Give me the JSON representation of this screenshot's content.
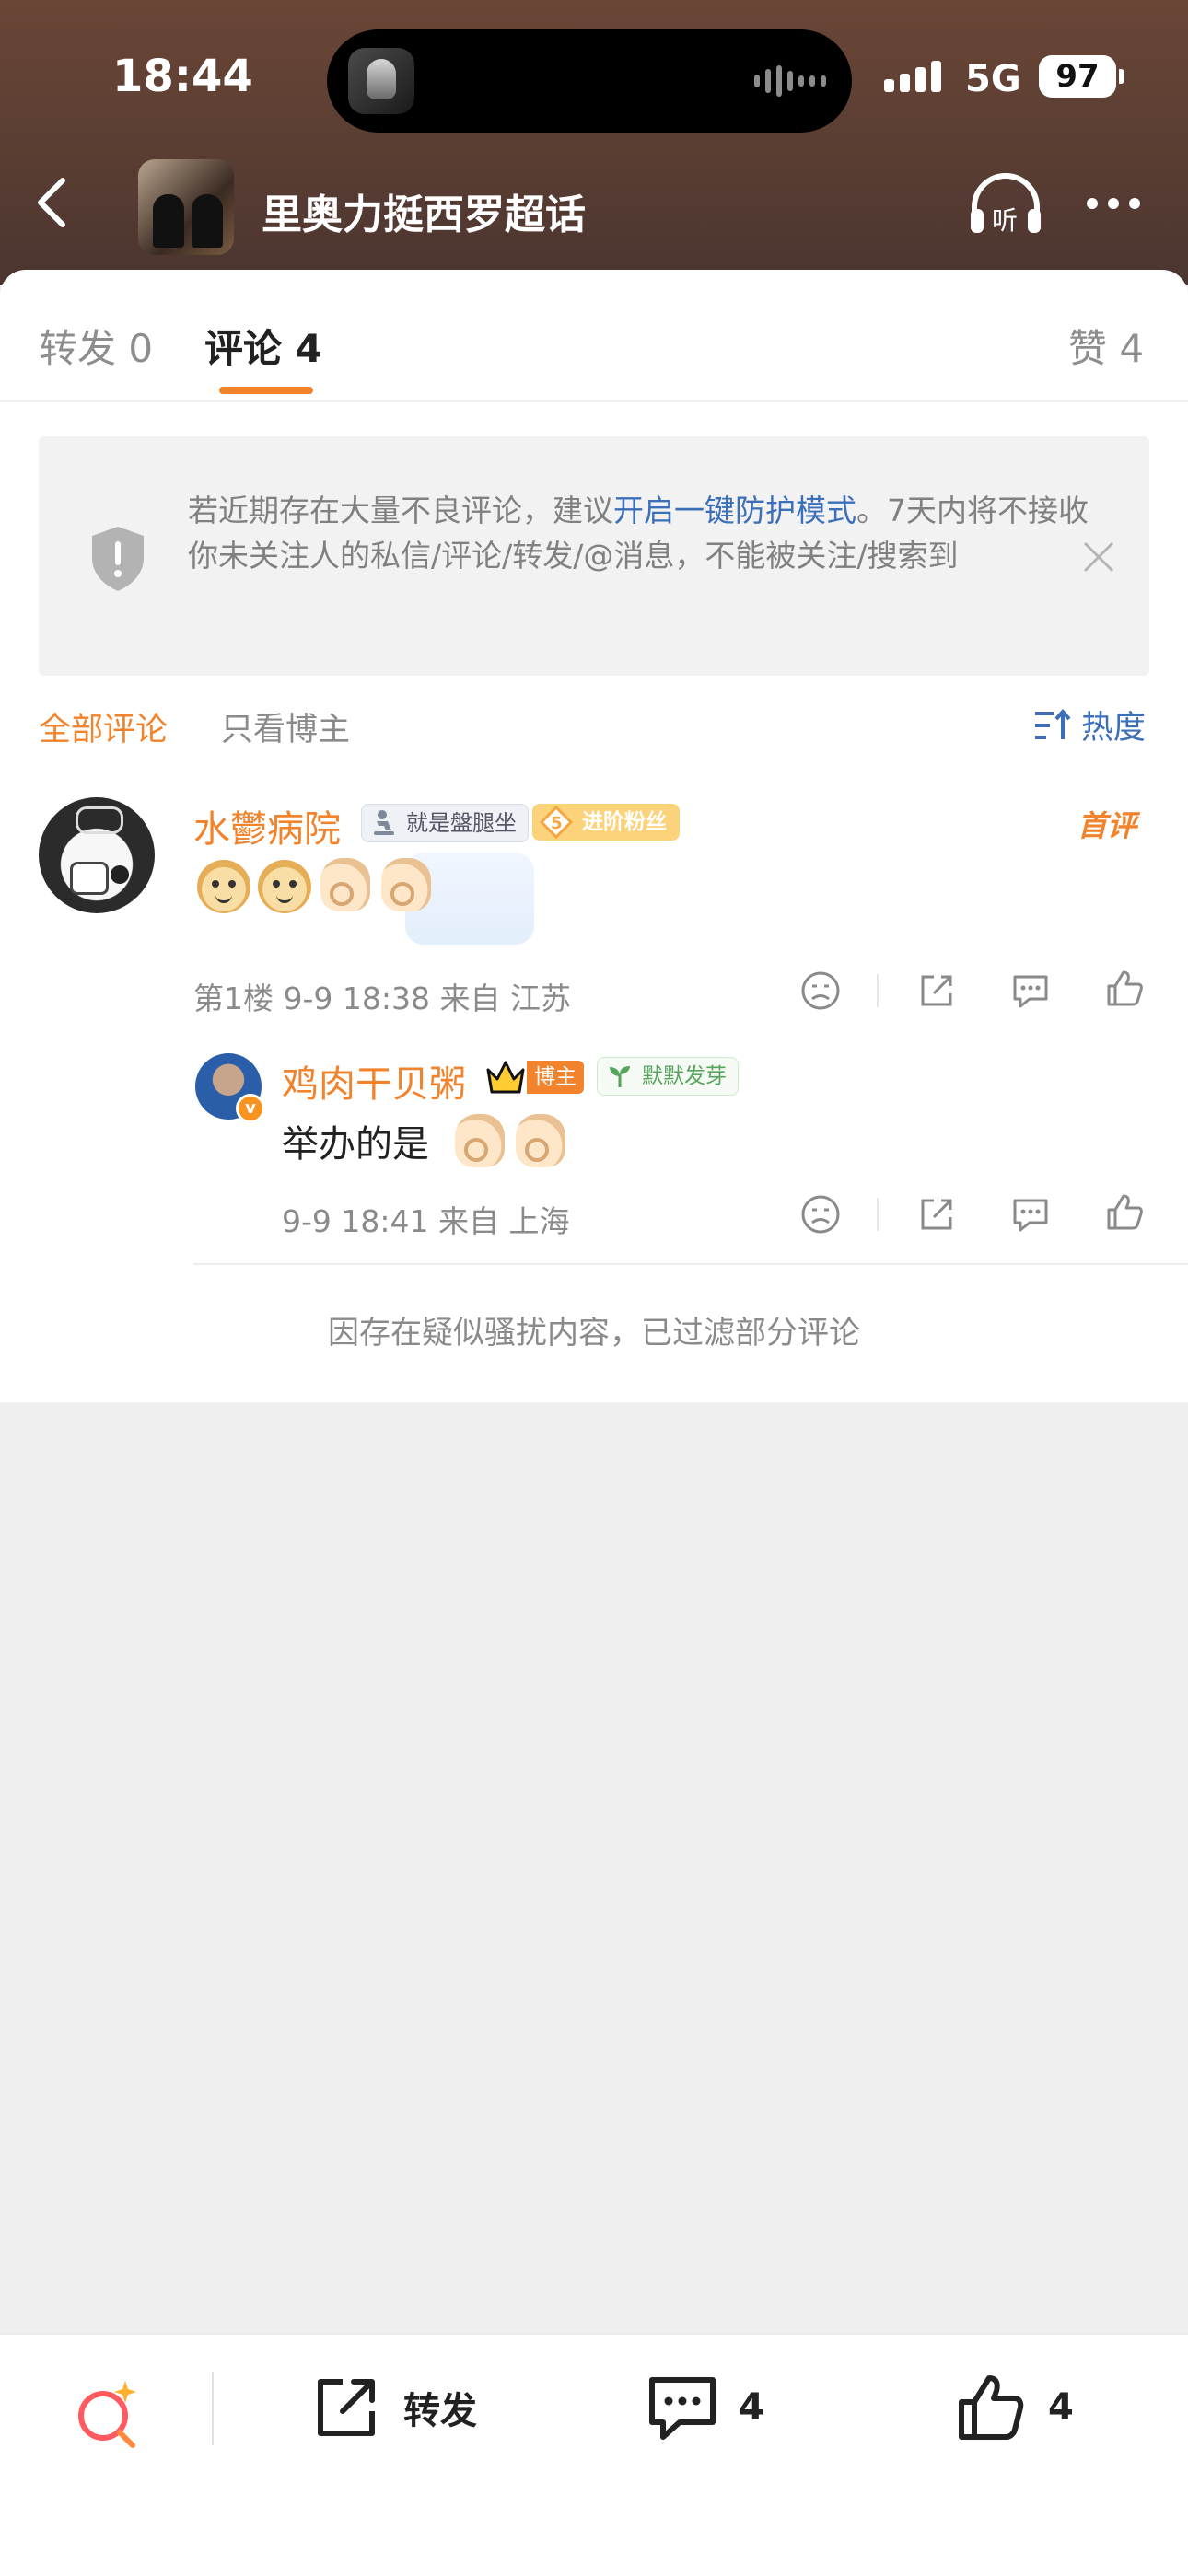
{
  "status_bar": {
    "time": "18:44",
    "network": "5G",
    "battery": "97"
  },
  "header": {
    "title": "里奥力挺西罗超话"
  },
  "tabs": [
    {
      "label": "转发",
      "count": "0"
    },
    {
      "label": "评论",
      "count": "4"
    },
    {
      "label": "赞",
      "count": "4"
    }
  ],
  "notice": {
    "prefix": "若近期存在大量不良评论，建议",
    "link": "开启一键防护模式",
    "suffix": "。7天内将不接收你未关注人的私信/评论/转发/@消息，不能被关注/搜索到"
  },
  "filters": {
    "all": "全部评论",
    "host_only": "只看博主",
    "sort": "热度"
  },
  "comment": {
    "username": "水鬱病院",
    "badge_sit": "就是盤腿坐",
    "badge_fan_level": "5",
    "badge_fan": "进阶粉丝",
    "first_tag": "首评",
    "meta": "第1楼  9-9 18:38  来自 江苏"
  },
  "reply": {
    "username": "鸡肉干贝粥",
    "badge_host": "博主",
    "badge_sprout": "默默发芽",
    "text": "举办的是",
    "meta": "9-9 18:41  来自 上海"
  },
  "filtered_notice": "因存在疑似骚扰内容，已过滤部分评论",
  "bottom_bar": {
    "repost": "转发",
    "comments": "4",
    "likes": "4"
  },
  "colors": {
    "accent": "#f0832b",
    "link": "#3c6fb8"
  }
}
